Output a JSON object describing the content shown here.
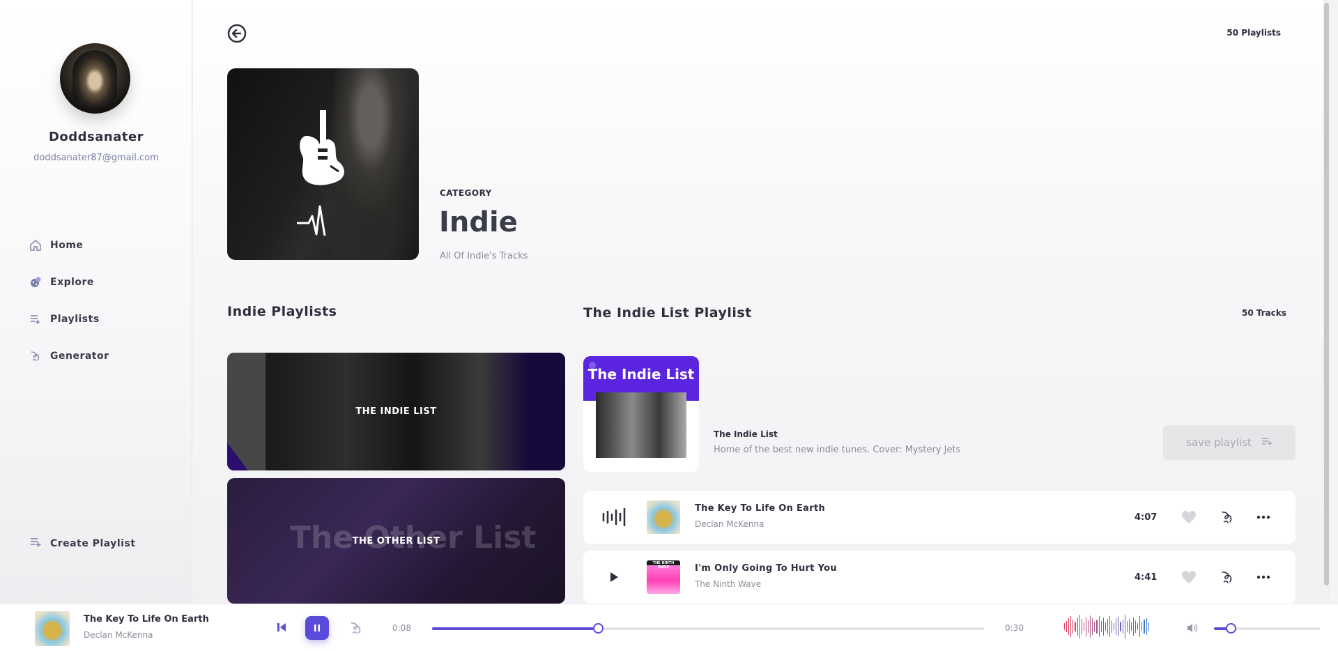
{
  "user": {
    "name": "Doddsanater",
    "email": "doddsanater87@gmail.com"
  },
  "nav": [
    {
      "label": "Home",
      "icon": "home-icon"
    },
    {
      "label": "Explore",
      "icon": "explore-icon"
    },
    {
      "label": "Playlists",
      "icon": "playlist-icon"
    },
    {
      "label": "Generator",
      "icon": "generator-icon"
    }
  ],
  "create_playlist_label": "Create Playlist",
  "header": {
    "playlist_count": "50 Playlists"
  },
  "category": {
    "label": "CATEGORY",
    "title": "Indie",
    "subtitle": "All Of Indie's Tracks"
  },
  "sections": {
    "left_title": "Indie Playlists",
    "right_title": "The Indie List Playlist",
    "tracks_count": "50 Tracks"
  },
  "playlist_cards": [
    {
      "label": "THE INDIE LIST"
    },
    {
      "label": "THE OTHER LIST",
      "background_text": "The Other List"
    }
  ],
  "featured": {
    "cover_title": "The Indie List",
    "name": "The Indie List",
    "description": "Home of the best new indie tunes. Cover: Mystery Jets",
    "save_label": "save playlist"
  },
  "tracks": [
    {
      "name": "The Key To Life On Earth",
      "artist": "Declan McKenna",
      "duration": "4:07",
      "state": "playing"
    },
    {
      "name": "I'm Only Going To Hurt You",
      "artist": "The Ninth Wave",
      "duration": "4:41",
      "state": "paused",
      "art_text": "THE NINTH WAVE"
    }
  ],
  "player": {
    "track": "The Key To Life On Earth",
    "artist": "Declan McKenna",
    "current_time": "0:08",
    "end_time": "0:30",
    "progress": 0.3,
    "volume": 0.16
  },
  "colors": {
    "accent": "#5b4bdb",
    "featured_purple": "#5b25e0"
  }
}
